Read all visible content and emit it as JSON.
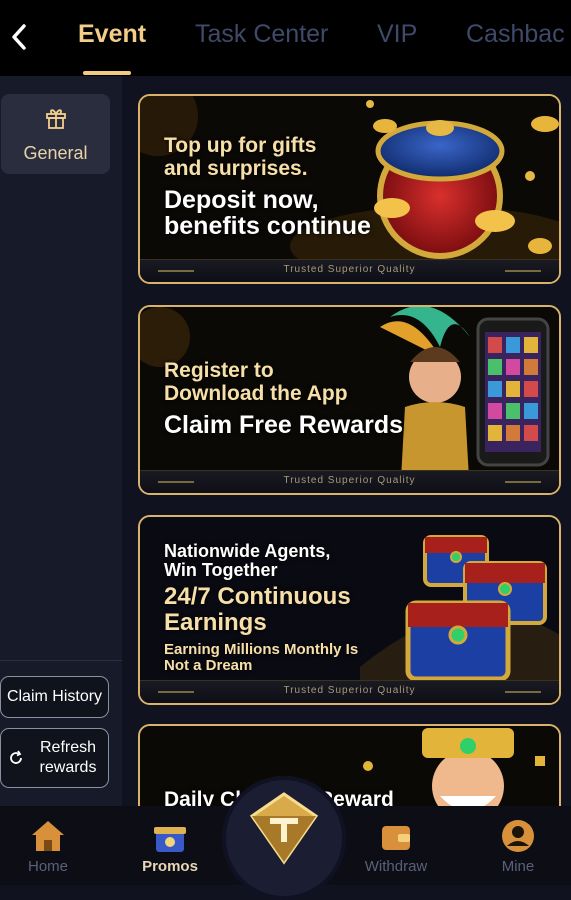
{
  "header": {
    "tabs": [
      {
        "label": "Event",
        "active": true
      },
      {
        "label": "Task Center",
        "active": false
      },
      {
        "label": "VIP",
        "active": false
      },
      {
        "label": "Cashbac",
        "active": false
      }
    ]
  },
  "sidebar": {
    "items": [
      {
        "label": "General",
        "icon": "gift-icon",
        "active": true
      }
    ],
    "claim_history": "Claim History",
    "refresh_line1": "Refresh",
    "refresh_line2": "rewards"
  },
  "banners": [
    {
      "lines": [
        "Top up for gifts",
        "and surprises.",
        "Deposit now,",
        "benefits continue"
      ],
      "footer": "Trusted Superior Quality"
    },
    {
      "lines": [
        "Register to",
        "Download the App",
        "Claim Free Rewards"
      ],
      "footer": "Trusted Superior Quality"
    },
    {
      "lines": [
        "Nationwide Agents,",
        "Win Together",
        "24/7 Continuous",
        "Earnings",
        "Earning Millions Monthly Is",
        "Not a Dream"
      ],
      "footer": "Trusted Superior Quality"
    },
    {
      "lines": [
        "Daily Ch",
        "Reward"
      ]
    }
  ],
  "bottom_nav": {
    "items": [
      {
        "label": "Home",
        "active": false
      },
      {
        "label": "Promos",
        "active": true
      },
      {
        "label": "Withdraw",
        "active": false
      },
      {
        "label": "Mine",
        "active": false
      }
    ]
  },
  "colors": {
    "accent": "#f4ce88",
    "banner_border": "#d9b36b",
    "background": "#10121f"
  }
}
